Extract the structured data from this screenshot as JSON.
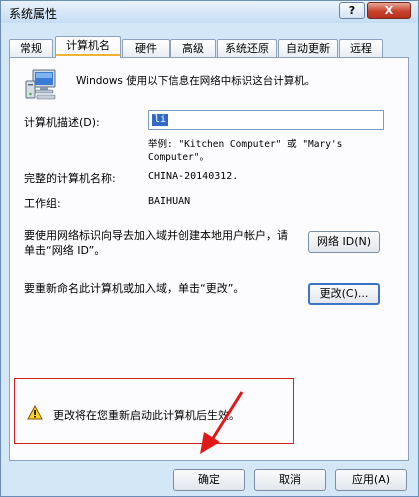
{
  "window": {
    "title": "系统属性",
    "help_label": "?",
    "close_label": "X"
  },
  "tabs": [
    {
      "label": "常规"
    },
    {
      "label": "计算机名"
    },
    {
      "label": "硬件"
    },
    {
      "label": "高级"
    },
    {
      "label": "系统还原"
    },
    {
      "label": "自动更新"
    },
    {
      "label": "远程"
    }
  ],
  "active_tab": "计算机名",
  "panel": {
    "info_text": "Windows 使用以下信息在网络中标识这台计算机。",
    "description_label": "计算机描述(D):",
    "description_value": "li",
    "example_text": "举例: \"Kitchen Computer\" 或 \"Mary's Computer\"。",
    "full_name_label": "完整的计算机名称:",
    "full_name_value": "CHINA-20140312.",
    "workgroup_label": "工作组:",
    "workgroup_value": "BAIHUAN",
    "network_id_text": "要使用网络标识向导去加入域并创建本地用户帐户，请单击“网络 ID”。",
    "network_id_button": "网络 ID(N)",
    "rename_text": "要重新命名此计算机或加入域，单击“更改”。",
    "change_button": "更改(C)...",
    "warning_text": "更改将在您重新启动此计算机后生效。"
  },
  "footer": {
    "ok": "确定",
    "cancel": "取消",
    "apply": "应用(A)"
  },
  "colors": {
    "accent": "#3169c6",
    "warning_border": "#d22020",
    "arrow": "#e01818"
  }
}
